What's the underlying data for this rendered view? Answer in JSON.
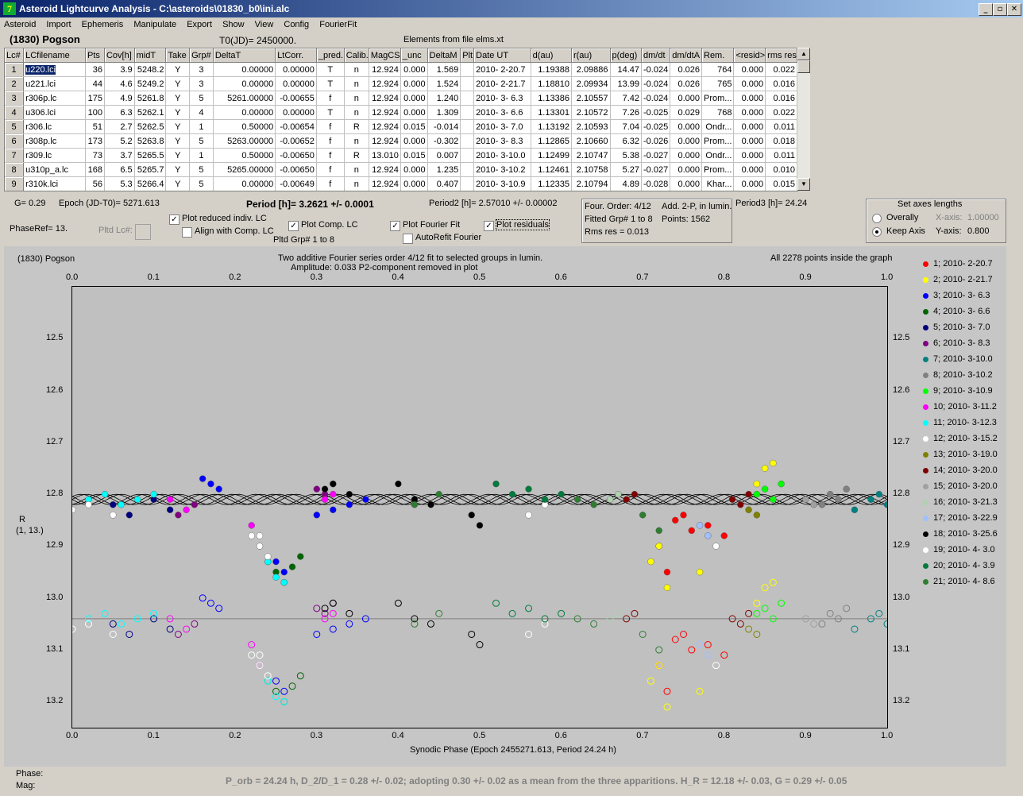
{
  "window": {
    "title": "Asteroid Lightcurve Analysis - C:\\asteroids\\01830_b0\\ini.alc"
  },
  "menu": [
    "Asteroid",
    "Import",
    "Ephemeris",
    "Manipulate",
    "Export",
    "Show",
    "View",
    "Config",
    "FourierFit"
  ],
  "asteroid_name": "(1830) Pogson",
  "t0": "T0(JD)= 2450000.",
  "elements": "Elements from file elms.xt",
  "table": {
    "headers": [
      "Lc#",
      "LCfilename",
      "Pts",
      "Cov[h]",
      "midT",
      "Take",
      "Grp#",
      "DeltaT",
      "LtCorr.",
      "_pred.",
      "Calib.",
      "MagCS",
      "_unc",
      "DeltaM",
      "Plt",
      "Date UT",
      "d(au)",
      "r(au)",
      "p(deg)",
      "dm/dt",
      "dm/dtA",
      "Rem.",
      "<resid>",
      "rms res"
    ],
    "rows": [
      [
        "1",
        "u220.lci",
        "36",
        "3.9",
        "5248.2",
        "Y",
        "3",
        "0.00000",
        "0.00000",
        "T",
        "n",
        "12.924",
        "0.000",
        "1.569",
        "",
        "2010- 2-20.7",
        "1.19388",
        "2.09886",
        "14.47",
        "-0.024",
        "0.026",
        "764",
        "0.000",
        "0.022"
      ],
      [
        "2",
        "u221.lci",
        "44",
        "4.6",
        "5249.2",
        "Y",
        "3",
        "0.00000",
        "0.00000",
        "T",
        "n",
        "12.924",
        "0.000",
        "1.524",
        "",
        "2010- 2-21.7",
        "1.18810",
        "2.09934",
        "13.99",
        "-0.024",
        "0.026",
        "765",
        "0.000",
        "0.016"
      ],
      [
        "3",
        "r306p.lc",
        "175",
        "4.9",
        "5261.8",
        "Y",
        "5",
        "5261.00000",
        "-0.00655",
        "f",
        "n",
        "12.924",
        "0.000",
        "1.240",
        "",
        "2010- 3- 6.3",
        "1.13386",
        "2.10557",
        "7.42",
        "-0.024",
        "0.000",
        "Prom...",
        "0.000",
        "0.016"
      ],
      [
        "4",
        "u306.lci",
        "100",
        "6.3",
        "5262.1",
        "Y",
        "4",
        "0.00000",
        "0.00000",
        "T",
        "n",
        "12.924",
        "0.000",
        "1.309",
        "",
        "2010- 3- 6.6",
        "1.13301",
        "2.10572",
        "7.26",
        "-0.025",
        "0.029",
        "768",
        "0.000",
        "0.022"
      ],
      [
        "5",
        "r306.lc",
        "51",
        "2.7",
        "5262.5",
        "Y",
        "1",
        "0.50000",
        "-0.00654",
        "f",
        "R",
        "12.924",
        "0.015",
        "-0.014",
        "",
        "2010- 3- 7.0",
        "1.13192",
        "2.10593",
        "7.04",
        "-0.025",
        "0.000",
        "Ondr...",
        "0.000",
        "0.011"
      ],
      [
        "6",
        "r308p.lc",
        "173",
        "5.2",
        "5263.8",
        "Y",
        "5",
        "5263.00000",
        "-0.00652",
        "f",
        "n",
        "12.924",
        "0.000",
        "-0.302",
        "",
        "2010- 3- 8.3",
        "1.12865",
        "2.10660",
        "6.32",
        "-0.026",
        "0.000",
        "Prom...",
        "0.000",
        "0.018"
      ],
      [
        "7",
        "r309.lc",
        "73",
        "3.7",
        "5265.5",
        "Y",
        "1",
        "0.50000",
        "-0.00650",
        "f",
        "R",
        "13.010",
        "0.015",
        "0.007",
        "",
        "2010- 3-10.0",
        "1.12499",
        "2.10747",
        "5.38",
        "-0.027",
        "0.000",
        "Ondr...",
        "0.000",
        "0.011"
      ],
      [
        "8",
        "u310p_a.lc",
        "168",
        "6.5",
        "5265.7",
        "Y",
        "5",
        "5265.00000",
        "-0.00650",
        "f",
        "n",
        "12.924",
        "0.000",
        "1.235",
        "",
        "2010- 3-10.2",
        "1.12461",
        "2.10758",
        "5.27",
        "-0.027",
        "0.000",
        "Prom...",
        "0.000",
        "0.010"
      ],
      [
        "9",
        "r310k.lci",
        "56",
        "5.3",
        "5266.4",
        "Y",
        "5",
        "0.00000",
        "-0.00649",
        "f",
        "n",
        "12.924",
        "0.000",
        "0.407",
        "",
        "2010- 3-10.9",
        "1.12335",
        "2.10794",
        "4.89",
        "-0.028",
        "0.000",
        "Khar...",
        "0.000",
        "0.015"
      ]
    ]
  },
  "info": {
    "g": "G= 0.29",
    "epoch": "Epoch (JD-T0)= 5271.613",
    "period": "Period [h]= 3.2621 +/- 0.0001",
    "period2": "Period2 [h]= 2.57010 +/- 0.00002",
    "period3": "Period3 [h]= 24.24",
    "phaseref": "PhaseRef= 13.",
    "pltd_lc": "Pltd Lc#:",
    "pltd_grp": "Pltd Grp#  1  to   8"
  },
  "checks": {
    "plot_reduced": "Plot reduced indiv. LC",
    "align": "Align with Comp. LC",
    "plot_comp": "Plot Comp. LC",
    "plot_fourier": "Plot Fourier Fit",
    "plot_residuals": "Plot residuals",
    "autorefit": "AutoRefit Fourier"
  },
  "fourier_box": {
    "order": "Four. Order:  4/12",
    "add": "Add. 2-P, in lumin.",
    "fitted": "Fitted Grp# 1 to 8",
    "points": "Points: 1562",
    "rms": "Rms res    = 0.013"
  },
  "axes_box": {
    "title": "Set axes lengths",
    "overally": "Overally",
    "keep": "Keep Axis",
    "xaxis": "X-axis:",
    "xval": "1.00000",
    "yaxis": "Y-axis:",
    "yval": "0.800"
  },
  "plot": {
    "name": "(1830) Pogson",
    "desc1": "Two additive Fourier series order 4/12 fit to selected groups in lumin.",
    "desc2": "Amplitude: 0.033                    P2-component removed in plot",
    "inside": "All 2278 points inside the graph",
    "ylabel1": "R",
    "ylabel2": "(1, 13.)",
    "xlabel": "Synodic Phase (Epoch 2455271.613, Period 24.24 h)"
  },
  "chart_data": {
    "type": "scatter",
    "xlim": [
      0.0,
      1.0
    ],
    "ylim": [
      13.25,
      12.4
    ],
    "xticks": [
      "0.0",
      "0.1",
      "0.2",
      "0.3",
      "0.4",
      "0.5",
      "0.6",
      "0.7",
      "0.8",
      "0.9",
      "1.0"
    ],
    "yticks": [
      "12.5",
      "12.6",
      "12.7",
      "12.8",
      "12.9",
      "13.0",
      "13.1",
      "13.2"
    ],
    "series": [
      {
        "name": "1; 2010- 2-20.7",
        "color": "#ff0000",
        "x": [
          0.72,
          0.74,
          0.76,
          0.78,
          0.8,
          0.73,
          0.75
        ],
        "y": [
          12.9,
          12.85,
          12.87,
          12.86,
          12.88,
          12.95,
          12.84
        ]
      },
      {
        "name": "2; 2010- 2-21.7",
        "color": "#ffff00",
        "x": [
          0.71,
          0.73,
          0.77,
          0.85,
          0.86,
          0.72,
          0.84
        ],
        "y": [
          12.93,
          12.98,
          12.95,
          12.75,
          12.74,
          12.9,
          12.78
        ]
      },
      {
        "name": "3; 2010- 3- 6.3",
        "color": "#0000ff",
        "x": [
          0.16,
          0.17,
          0.18,
          0.25,
          0.26,
          0.3,
          0.32,
          0.34,
          0.36
        ],
        "y": [
          12.77,
          12.78,
          12.79,
          12.93,
          12.95,
          12.84,
          12.83,
          12.82,
          12.81
        ]
      },
      {
        "name": "4; 2010- 3- 6.6",
        "color": "#006400",
        "x": [
          0.24,
          0.25,
          0.26,
          0.27,
          0.28
        ],
        "y": [
          12.93,
          12.95,
          12.97,
          12.94,
          12.92
        ]
      },
      {
        "name": "5; 2010- 3- 7.0",
        "color": "#000080",
        "x": [
          0.05,
          0.07,
          0.1,
          0.12
        ],
        "y": [
          12.82,
          12.84,
          12.81,
          12.83
        ]
      },
      {
        "name": "6; 2010- 3- 8.3",
        "color": "#800080",
        "x": [
          0.13,
          0.15,
          0.3,
          0.31,
          0.32
        ],
        "y": [
          12.84,
          12.82,
          12.79,
          12.8,
          12.78
        ]
      },
      {
        "name": "7; 2010- 3-10.0",
        "color": "#008080",
        "x": [
          0.98,
          0.99,
          1.0,
          0.96
        ],
        "y": [
          12.81,
          12.8,
          12.82,
          12.83
        ]
      },
      {
        "name": "8; 2010- 3-10.2",
        "color": "#808080",
        "x": [
          0.92,
          0.93,
          0.94,
          0.95
        ],
        "y": [
          12.82,
          12.8,
          12.81,
          12.79
        ]
      },
      {
        "name": "9; 2010- 3-10.9",
        "color": "#00ff00",
        "x": [
          0.84,
          0.85,
          0.86,
          0.87
        ],
        "y": [
          12.8,
          12.79,
          12.81,
          12.78
        ]
      },
      {
        "name": "10; 2010- 3-11.2",
        "color": "#ff00ff",
        "x": [
          0.12,
          0.14,
          0.22,
          0.23,
          0.31,
          0.32
        ],
        "y": [
          12.81,
          12.83,
          12.86,
          12.9,
          12.81,
          12.8
        ]
      },
      {
        "name": "11; 2010- 3-12.3",
        "color": "#00ffff",
        "x": [
          0.02,
          0.04,
          0.06,
          0.08,
          0.1,
          0.24,
          0.25,
          0.26
        ],
        "y": [
          12.81,
          12.8,
          12.82,
          12.81,
          12.8,
          12.93,
          12.96,
          12.97
        ]
      },
      {
        "name": "12; 2010- 3-15.2",
        "color": "#ffffff",
        "x": [
          0.0,
          0.02,
          0.05,
          0.22,
          0.23,
          0.24
        ],
        "y": [
          12.83,
          12.82,
          12.84,
          12.88,
          12.9,
          12.92
        ]
      },
      {
        "name": "13; 2010- 3-19.0",
        "color": "#808000",
        "x": [
          0.83,
          0.84
        ],
        "y": [
          12.83,
          12.84
        ]
      },
      {
        "name": "14; 2010- 3-20.0",
        "color": "#800000",
        "x": [
          0.68,
          0.69,
          0.81,
          0.82,
          0.83
        ],
        "y": [
          12.81,
          12.8,
          12.81,
          12.82,
          12.8
        ]
      },
      {
        "name": "15; 2010- 3-20.0",
        "color": "#a0a0a0",
        "x": [
          0.9,
          0.91
        ],
        "y": [
          12.81,
          12.82
        ]
      },
      {
        "name": "16; 2010- 3-21.3",
        "color": "#b0d0b0",
        "x": [
          0.66,
          0.67
        ],
        "y": [
          12.81,
          12.8
        ]
      },
      {
        "name": "17; 2010- 3-22.9",
        "color": "#a0c0ff",
        "x": [
          0.77,
          0.78
        ],
        "y": [
          12.86,
          12.88
        ]
      },
      {
        "name": "18; 2010- 3-25.6",
        "color": "#000000",
        "x": [
          0.31,
          0.32,
          0.34,
          0.4,
          0.42,
          0.44,
          0.49,
          0.5
        ],
        "y": [
          12.79,
          12.78,
          12.8,
          12.78,
          12.81,
          12.82,
          12.84,
          12.86
        ]
      },
      {
        "name": "19; 2010- 4- 3.0",
        "color": "#ffffff",
        "x": [
          0.23,
          0.56,
          0.58,
          0.79
        ],
        "y": [
          12.88,
          12.84,
          12.82,
          12.9
        ]
      },
      {
        "name": "20; 2010- 4- 3.9",
        "color": "#007a3d",
        "x": [
          0.52,
          0.54,
          0.56,
          0.58,
          0.6
        ],
        "y": [
          12.78,
          12.8,
          12.79,
          12.81,
          12.8
        ]
      },
      {
        "name": "21; 2010- 4- 8.6",
        "color": "#2e7d32",
        "x": [
          0.42,
          0.45,
          0.62,
          0.64,
          0.7,
          0.72
        ],
        "y": [
          12.82,
          12.8,
          12.81,
          12.82,
          12.84,
          12.87
        ]
      }
    ]
  },
  "status": {
    "phase": "Phase:",
    "mag": "Mag:",
    "note": "P_orb = 24.24 h, D_2/D_1 = 0.28 +/- 0.02; adopting 0.30 +/- 0.02 as a mean from the three apparitions. H_R = 12.18 +/- 0.03, G = 0.29 +/- 0.05"
  }
}
